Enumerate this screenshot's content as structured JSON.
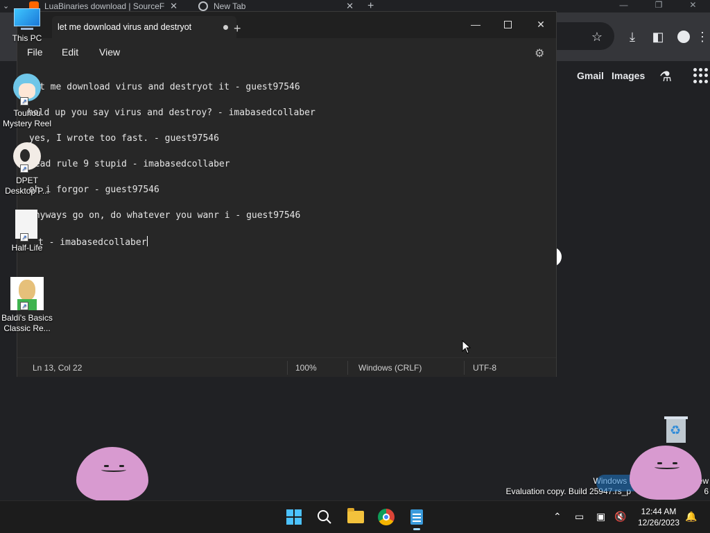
{
  "browser": {
    "tabs": [
      {
        "title": "LuaBinaries download | SourceF"
      },
      {
        "title": "New Tab"
      }
    ],
    "links": {
      "gmail": "Gmail",
      "images": "Images"
    }
  },
  "desktop": {
    "icons": [
      {
        "label1": "This PC",
        "label2": ""
      },
      {
        "label1": "Touhou",
        "label2": "Mystery Reel"
      },
      {
        "label1": "DPET",
        "label2": "Desktop P..."
      },
      {
        "label1": "Half-Life",
        "label2": ""
      },
      {
        "label1": "Baldi's Basics",
        "label2": "Classic Re..."
      }
    ],
    "watermark": {
      "line1": "Windows 11",
      "line1_tail": "ew",
      "line2": "Evaluation copy. Build 25947.rs_p",
      "line2_tail": "6"
    }
  },
  "notepad": {
    "tab_title": "let me download virus and destryot",
    "menu": {
      "file": "File",
      "edit": "Edit",
      "view": "View"
    },
    "lines": [
      "t me download virus and destryot it - guest97546",
      "hold up you say virus and destroy? - imabasedcollaber",
      "yes, I wrote too fast. - guest97546",
      "read rule 9 stupid - imabasedcollaber",
      "oh i forgor - guest97546",
      "anyways go on, do whatever you wanr i - guest97546",
      "t - imabasedcollaber"
    ],
    "status": {
      "position": "Ln 13, Col 22",
      "zoom": "100%",
      "line_ending": "Windows (CRLF)",
      "encoding": "UTF-8"
    }
  },
  "taskbar": {
    "time": "12:44 AM",
    "date": "12/26/2023"
  }
}
